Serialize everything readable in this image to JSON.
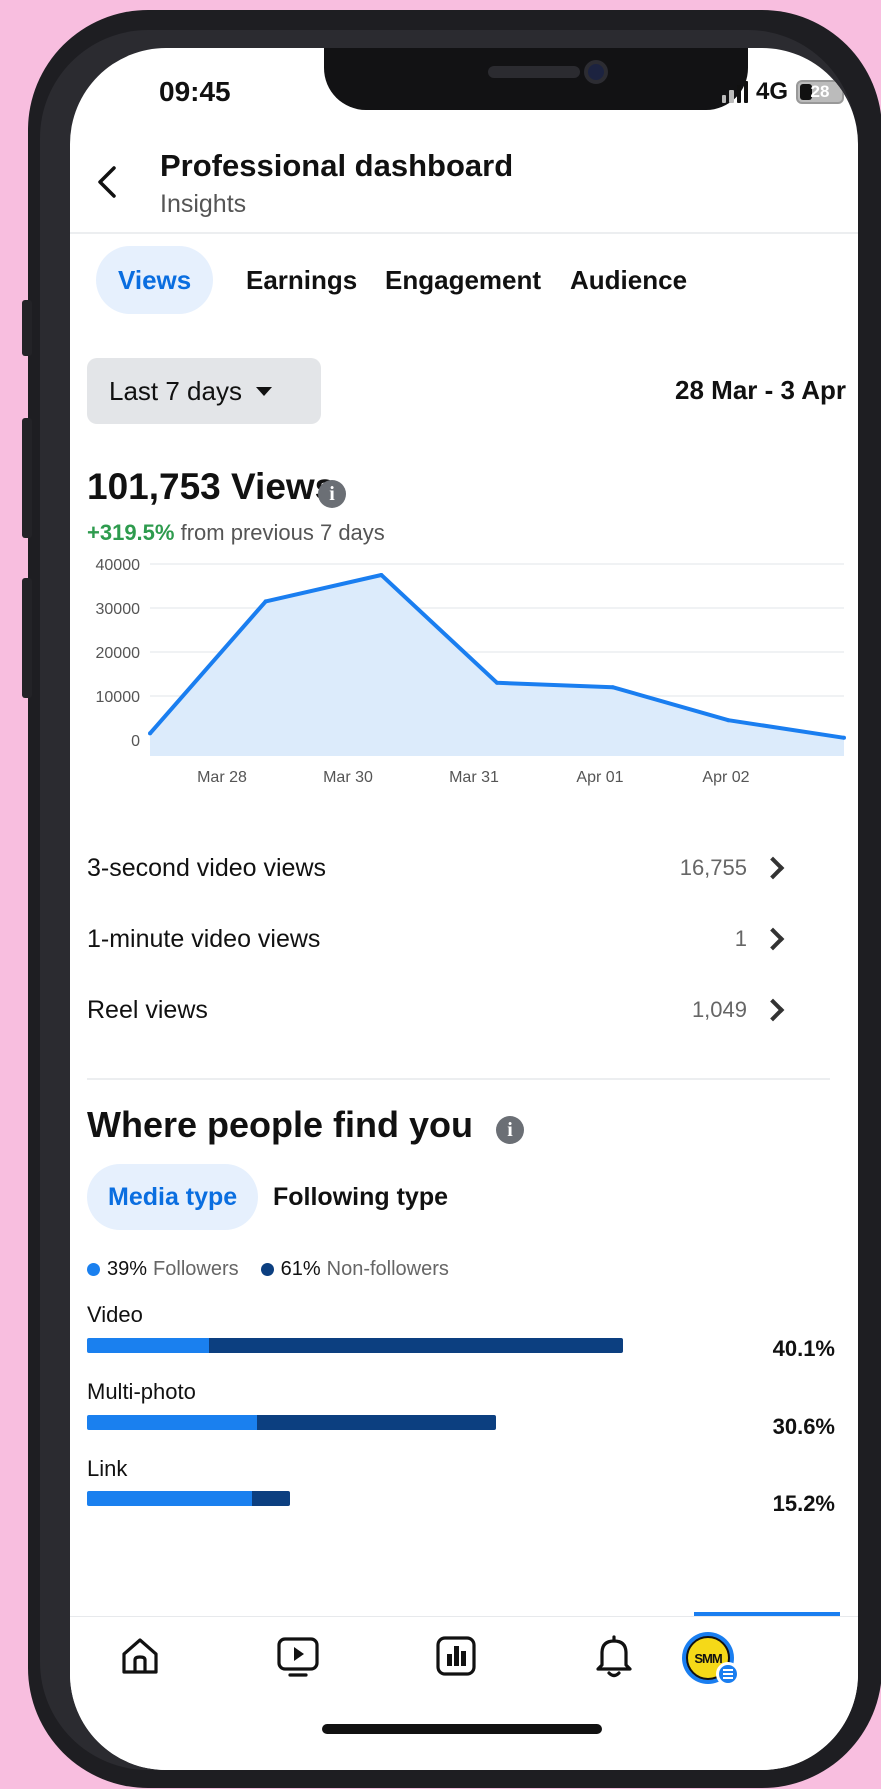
{
  "status_bar": {
    "time": "09:45",
    "network": "4G",
    "battery": "28"
  },
  "header": {
    "title": "Professional dashboard",
    "subtitle": "Insights"
  },
  "tabs": [
    {
      "label": "Views",
      "active": true
    },
    {
      "label": "Earnings",
      "active": false
    },
    {
      "label": "Engagement",
      "active": false
    },
    {
      "label": "Audience",
      "active": false
    }
  ],
  "filter": {
    "selected": "Last 7 days",
    "date_range": "28 Mar - 3 Apr"
  },
  "summary": {
    "total": "101,753 Views",
    "change": "+319.5%",
    "change_text": "from previous 7 days"
  },
  "chart_data": {
    "type": "area",
    "x_labels": [
      "Mar 28",
      "Mar 30",
      "Mar 31",
      "Apr 01",
      "Apr 02"
    ],
    "y_ticks": [
      40000,
      30000,
      20000,
      10000,
      0
    ],
    "ylim": [
      0,
      40000
    ],
    "series": [
      {
        "values": [
          1500,
          31500,
          37500,
          13000,
          12000,
          4500,
          500
        ]
      }
    ],
    "grid": true,
    "colors": {
      "line": "#1a7ef0",
      "fill": "#dcebfb"
    }
  },
  "metrics": [
    {
      "label": "3-second video views",
      "value": "16,755"
    },
    {
      "label": "1-minute video views",
      "value": "1"
    },
    {
      "label": "Reel views",
      "value": "1,049"
    }
  ],
  "where": {
    "title": "Where people find you",
    "subtabs": [
      {
        "label": "Media type",
        "active": true
      },
      {
        "label": "Following type",
        "active": false
      }
    ],
    "legend": [
      {
        "value": "39%",
        "label": "Followers",
        "color": "#1a80ef"
      },
      {
        "value": "61%",
        "label": "Non-followers",
        "color": "#0c3f80"
      }
    ],
    "breakdown": [
      {
        "label": "Video",
        "pct": "40.1%",
        "total": 40.1,
        "followers_fraction": 0.228
      },
      {
        "label": "Multi-photo",
        "pct": "30.6%",
        "total": 30.6,
        "followers_fraction": 0.416
      },
      {
        "label": "Link",
        "pct": "15.2%",
        "total": 15.2,
        "followers_fraction": 0.81
      }
    ]
  },
  "bottom_nav": [
    {
      "name": "home-icon"
    },
    {
      "name": "video-icon"
    },
    {
      "name": "insights-icon"
    },
    {
      "name": "bell-icon"
    },
    {
      "name": "profile-avatar"
    }
  ]
}
